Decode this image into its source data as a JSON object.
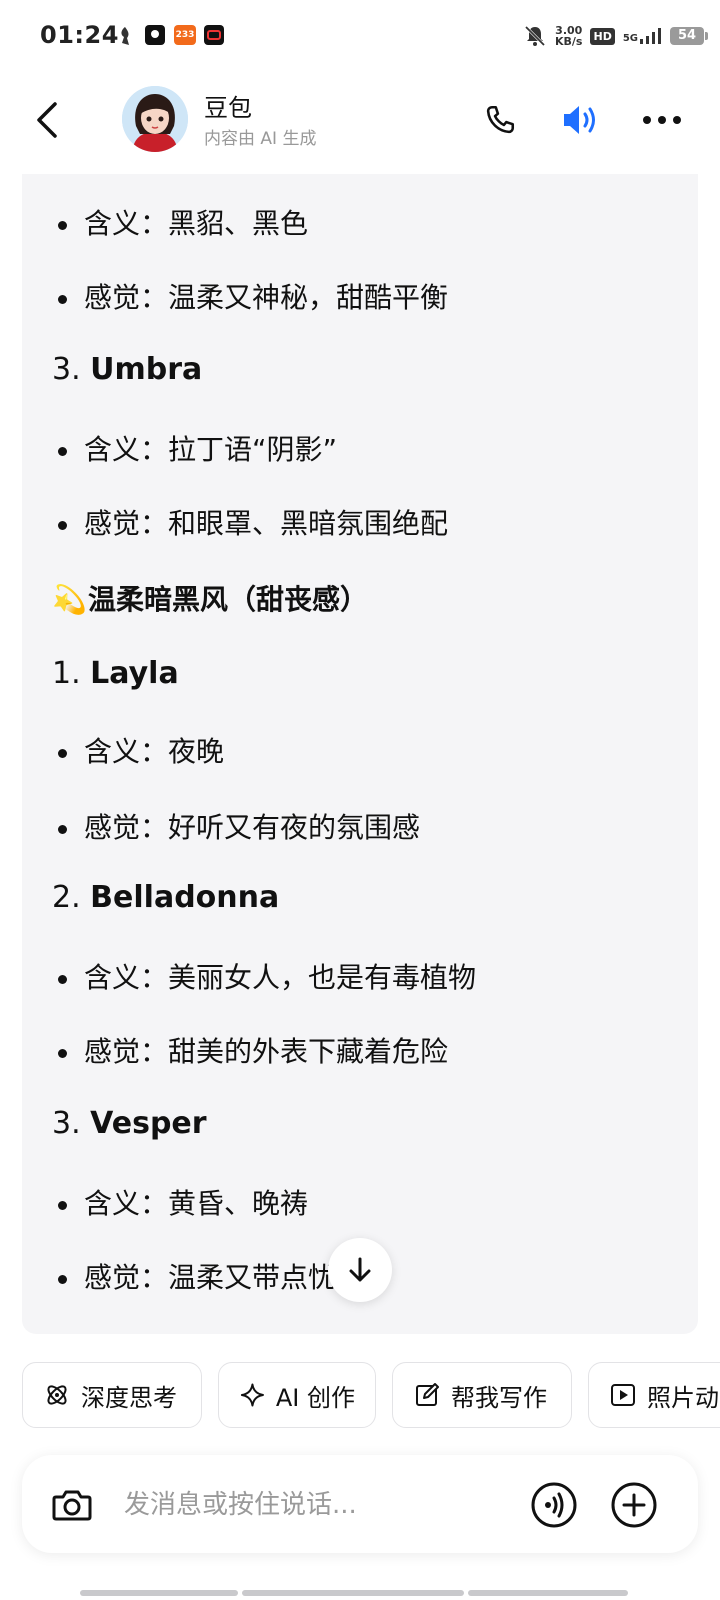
{
  "status_bar": {
    "time": "01:24",
    "net_speed_value": "3.00",
    "net_speed_unit": "KB/s",
    "hd": "HD",
    "signal": "5G",
    "battery": "54",
    "app3_badge": "233"
  },
  "header": {
    "title": "豆包",
    "subtitle": "内容由 AI 生成",
    "accent_color": "#1f6fff"
  },
  "message": {
    "lines": [
      {
        "type": "bullet",
        "text": "含义：黑貂、黑色"
      },
      {
        "type": "bullet",
        "text": "感觉：温柔又神秘，甜酷平衡"
      },
      {
        "type": "numbered",
        "num": "3.",
        "text": "Umbra"
      },
      {
        "type": "bullet",
        "text": "含义：拉丁语“阴影”"
      },
      {
        "type": "bullet",
        "text": "感觉：和眼罩、黑暗氛围绝配"
      },
      {
        "type": "section",
        "emoji": "💫",
        "text": "温柔暗黑风（甜丧感）"
      },
      {
        "type": "numbered",
        "num": "1.",
        "text": "Layla"
      },
      {
        "type": "bullet",
        "text": "含义：夜晚"
      },
      {
        "type": "bullet",
        "text": "感觉：好听又有夜的氛围感"
      },
      {
        "type": "numbered",
        "num": "2.",
        "text": "Belladonna"
      },
      {
        "type": "bullet",
        "text": "含义：美丽女人，也是有毒植物"
      },
      {
        "type": "bullet",
        "text": "感觉：甜美的外表下藏着危险"
      },
      {
        "type": "numbered",
        "num": "3.",
        "text": "Vesper"
      },
      {
        "type": "bullet",
        "text": "含义：黄昏、晚祷"
      },
      {
        "type": "bullet",
        "text": "感觉：温柔又带点忧郁"
      }
    ]
  },
  "quick_actions": [
    {
      "label": "深度思考",
      "icon": "atom-icon"
    },
    {
      "label": "AI 创作",
      "icon": "sparkle-icon"
    },
    {
      "label": "帮我写作",
      "icon": "edit-icon"
    },
    {
      "label": "照片动",
      "icon": "play-icon"
    }
  ],
  "input": {
    "placeholder": "发消息或按住说话..."
  }
}
